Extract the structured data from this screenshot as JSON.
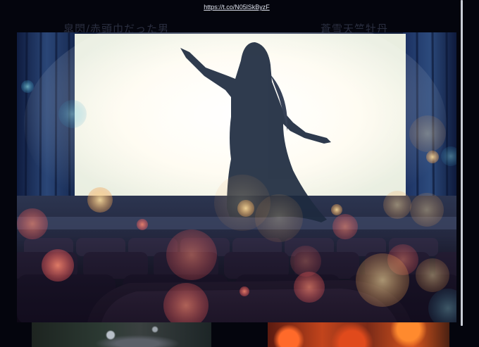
{
  "link": {
    "text": "https://t.co/N05lSkByzF"
  },
  "background": {
    "title_left": "皐閃/赤頭巾だった男",
    "title_right": "蒼雪天竺牡丹"
  },
  "colors": {
    "page_background": "#04050d",
    "link_text": "#dfe3ee",
    "screen_glow": "#fffdf4",
    "curtain": "#1c2f5a",
    "seats": "#241a2e",
    "bokeh_warm": "#ff6a5a",
    "bokeh_cool": "#5bc0d8"
  }
}
